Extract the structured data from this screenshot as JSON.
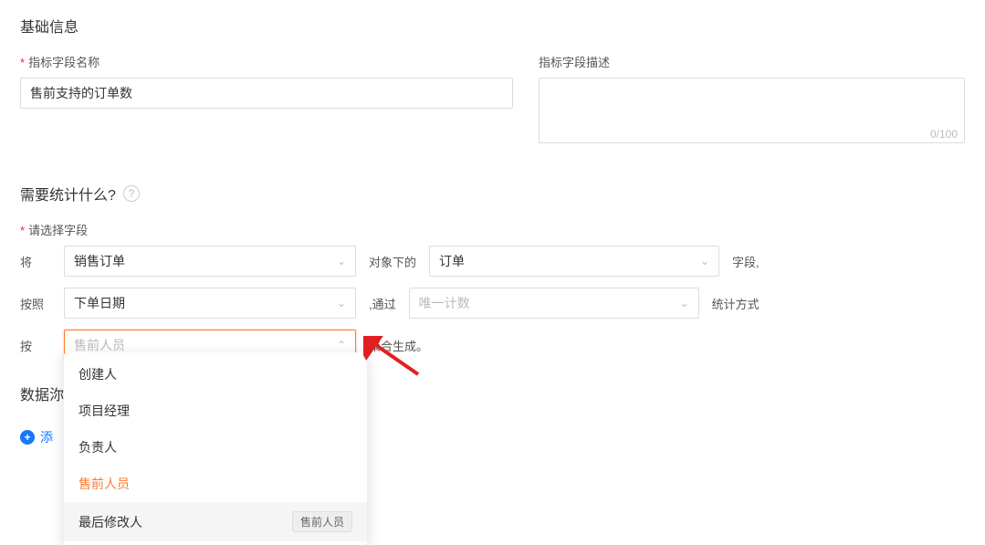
{
  "basicInfo": {
    "title": "基础信息",
    "fieldNameLabel": "指标字段名称",
    "fieldNameValue": "售前支持的订单数",
    "fieldDescLabel": "指标字段描述",
    "fieldDescValue": "",
    "charCount": "0/100"
  },
  "whatToStat": {
    "title": "需要统计什么?",
    "selectFieldLabel": "请选择字段",
    "rows": {
      "r1": {
        "label": "将",
        "leftValue": "销售订单",
        "mid": "对象下的",
        "rightValue": "订单",
        "trail": "字段,"
      },
      "r2": {
        "label": "按照",
        "leftValue": "下单日期",
        "mid": ",通过",
        "rightPlaceholder": "唯一计数",
        "trail": "统计方式"
      },
      "r3": {
        "label": "按",
        "leftPlaceholder": "售前人员",
        "mid": "聚合生成。"
      }
    }
  },
  "dataSection": {
    "titlePartial": "数据沵",
    "addLink": "添"
  },
  "dropdown": {
    "options": [
      {
        "label": "创建人"
      },
      {
        "label": "项目经理"
      },
      {
        "label": "负责人"
      },
      {
        "label": "售前人员",
        "selected": true
      },
      {
        "label": "最后修改人",
        "hover": true,
        "tag": "售前人员"
      }
    ]
  }
}
